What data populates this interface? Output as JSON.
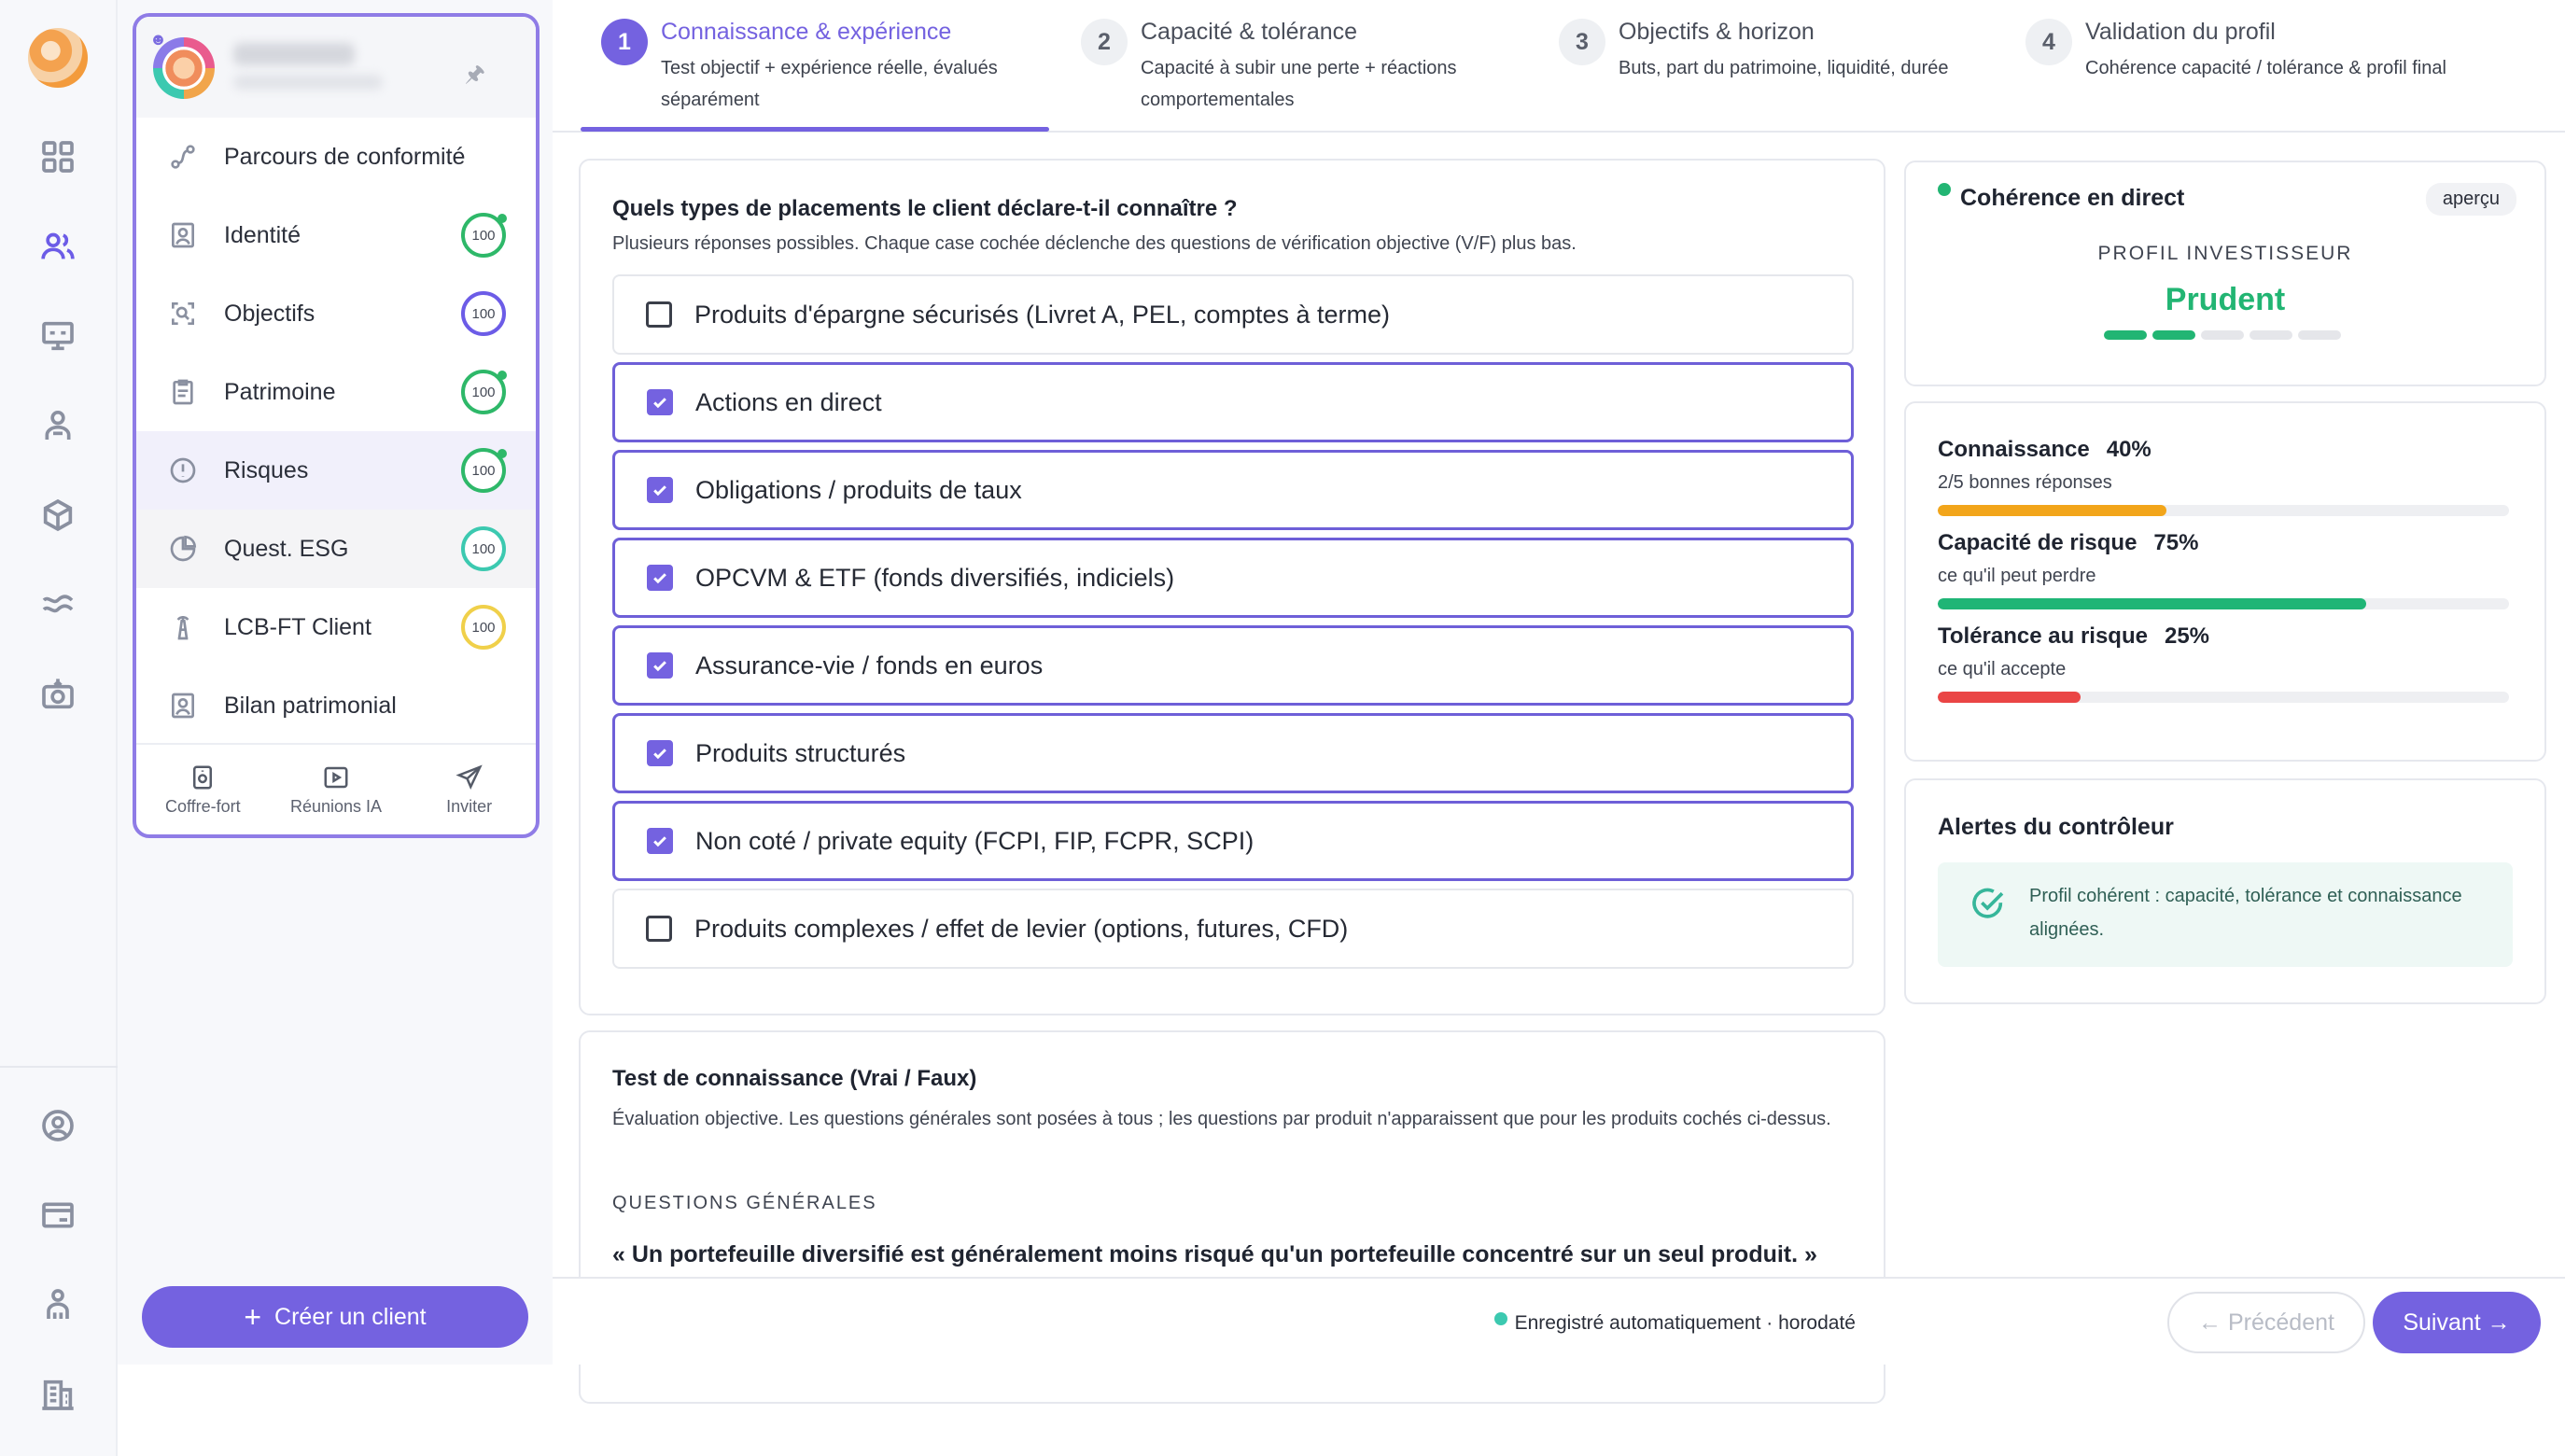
{
  "nav_rail": {
    "items": [
      "dashboard-grid",
      "clients-users",
      "presentation-board",
      "advisor-person",
      "box-package",
      "wave-transfer",
      "camera-import",
      "account-circle",
      "card-window",
      "team-person",
      "building"
    ]
  },
  "client_panel": {
    "nav": [
      {
        "label": "Parcours de conformité",
        "icon": "route-icon"
      },
      {
        "label": "Identité",
        "icon": "id-card-icon",
        "score": "100",
        "ring_color": "#2eb869",
        "dot": true
      },
      {
        "label": "Objectifs",
        "icon": "target-search-icon",
        "score": "100",
        "ring_color": "#6c5ce7",
        "dot": false
      },
      {
        "label": "Patrimoine",
        "icon": "clipboard-icon",
        "score": "100",
        "ring_color": "#2eb869",
        "dot": true
      },
      {
        "label": "Risques",
        "icon": "alert-circle-icon",
        "score": "100",
        "ring_color": "#2eb869",
        "dot": true
      },
      {
        "label": "Quest. ESG",
        "icon": "pie-icon",
        "score": "100",
        "ring_color": "#3cc9b0",
        "dot": false
      },
      {
        "label": "LCB-FT Client",
        "icon": "tower-icon",
        "score": "100",
        "ring_color": "#f0d04a",
        "dot": false
      },
      {
        "label": "Bilan patrimonial",
        "icon": "portrait-icon"
      }
    ],
    "footer": {
      "vault": "Coffre-fort",
      "meetings": "Réunions IA",
      "invite": "Inviter"
    }
  },
  "create_client": "Créer un client",
  "stepper": [
    {
      "num": "1",
      "title": "Connaissance & expérience",
      "desc": "Test objectif + expérience réelle, évalués séparément"
    },
    {
      "num": "2",
      "title": "Capacité & tolérance",
      "desc": "Capacité à subir une perte + réactions comportementales"
    },
    {
      "num": "3",
      "title": "Objectifs & horizon",
      "desc": "Buts, part du patrimoine, liquidité, durée"
    },
    {
      "num": "4",
      "title": "Validation du profil",
      "desc": "Cohérence capacité / tolérance & profil final"
    }
  ],
  "question": {
    "title": "Quels types de placements le client déclare-t-il connaître ?",
    "subtitle": "Plusieurs réponses possibles. Chaque case cochée déclenche des questions de vérification objective (V/F) plus bas.",
    "options": [
      {
        "label": "Produits d'épargne sécurisés (Livret A, PEL, comptes à terme)",
        "checked": false
      },
      {
        "label": "Actions en direct",
        "checked": true
      },
      {
        "label": "Obligations / produits de taux",
        "checked": true
      },
      {
        "label": "OPCVM & ETF (fonds diversifiés, indiciels)",
        "checked": true
      },
      {
        "label": "Assurance-vie / fonds en euros",
        "checked": true
      },
      {
        "label": "Produits structurés",
        "checked": true
      },
      {
        "label": "Non coté / private equity (FCPI, FIP, FCPR, SCPI)",
        "checked": true
      },
      {
        "label": "Produits complexes / effet de levier (options, futures, CFD)",
        "checked": false
      }
    ]
  },
  "test": {
    "title": "Test de connaissance (Vrai / Faux)",
    "desc": "Évaluation objective. Les questions générales sont posées à tous ; les questions par produit n'apparaissent que pour les produits cochés ci-dessus.",
    "section": "QUESTIONS GÉNÉRALES",
    "first_question": "« Un portefeuille diversifié est généralement moins risqué qu'un portefeuille concentré sur un seul produit. »"
  },
  "coherence": {
    "title": "Cohérence en direct",
    "badge": "aperçu",
    "profile_label": "PROFIL INVESTISSEUR",
    "profile_value": "Prudent",
    "level": 2,
    "level_max": 5,
    "accent": "#22b573"
  },
  "metrics": [
    {
      "label": "Connaissance",
      "pct": "40%",
      "value": 40,
      "sub": "2/5 bonnes réponses",
      "color": "#f2a51a"
    },
    {
      "label": "Capacité de risque",
      "pct": "75%",
      "value": 75,
      "sub": "ce qu'il peut perdre",
      "color": "#1fb576"
    },
    {
      "label": "Tolérance au risque",
      "pct": "25%",
      "value": 25,
      "sub": "ce qu'il accepte",
      "color": "#ea4545"
    }
  ],
  "alerts": {
    "title": "Alertes du contrôleur",
    "message": "Profil cohérent : capacité, tolérance et connaissance alignées."
  },
  "bottom": {
    "autosave": "Enregistré automatiquement · horodaté",
    "prev": "← Précédent",
    "next": "Suivant →"
  },
  "colors": {
    "brand": "#7462e0",
    "success": "#22b573"
  }
}
